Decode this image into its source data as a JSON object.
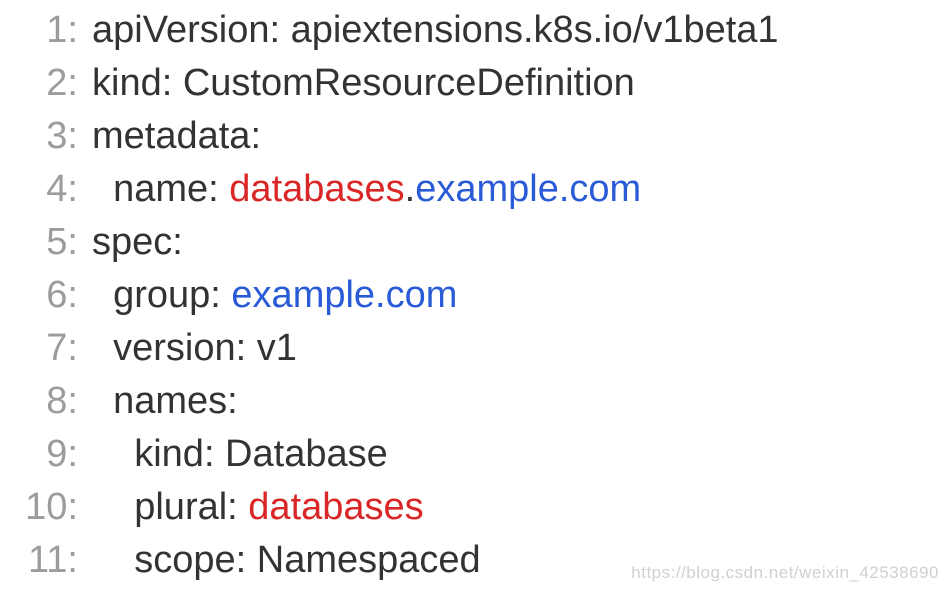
{
  "lines": [
    {
      "n": "1",
      "parts": [
        {
          "t": "apiVersion: apiextensions.k8s.io/v1beta1",
          "c": "txt"
        }
      ]
    },
    {
      "n": "2",
      "parts": [
        {
          "t": "kind: CustomResourceDefinition",
          "c": "txt"
        }
      ]
    },
    {
      "n": "3",
      "parts": [
        {
          "t": "metadata:",
          "c": "txt"
        }
      ]
    },
    {
      "n": "4",
      "parts": [
        {
          "t": "  name: ",
          "c": "txt"
        },
        {
          "t": "databases",
          "c": "red"
        },
        {
          "t": ".",
          "c": "txt"
        },
        {
          "t": "example.com",
          "c": "blue"
        }
      ]
    },
    {
      "n": "5",
      "parts": [
        {
          "t": "spec:",
          "c": "txt"
        }
      ]
    },
    {
      "n": "6",
      "parts": [
        {
          "t": "  group: ",
          "c": "txt"
        },
        {
          "t": "example.com",
          "c": "blue"
        }
      ]
    },
    {
      "n": "7",
      "parts": [
        {
          "t": "  version: v1",
          "c": "txt"
        }
      ]
    },
    {
      "n": "8",
      "parts": [
        {
          "t": "  names:",
          "c": "txt"
        }
      ]
    },
    {
      "n": "9",
      "parts": [
        {
          "t": "    kind: Database",
          "c": "txt"
        }
      ]
    },
    {
      "n": "10",
      "parts": [
        {
          "t": "    plural: ",
          "c": "txt"
        },
        {
          "t": "databases",
          "c": "red"
        }
      ]
    },
    {
      "n": "11",
      "parts": [
        {
          "t": "    scope: Namespaced",
          "c": "txt"
        }
      ]
    }
  ],
  "watermark": "https://blog.csdn.net/weixin_42538690"
}
